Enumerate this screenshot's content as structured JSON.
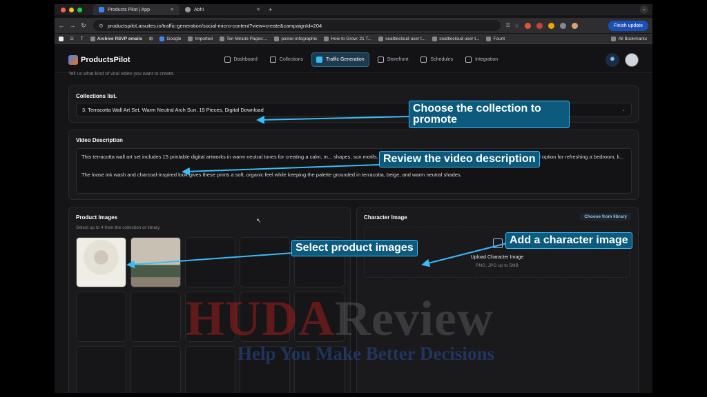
{
  "browser": {
    "tabs": [
      {
        "title": "Products Pilot | App"
      },
      {
        "title": "Abhi"
      }
    ],
    "url": "productspilot.aisuites.io/traffic-generation/social-micro-content?view=create&campaignId=204",
    "finish_update": "Finish update",
    "bookmarks": [
      "Archive RSVP emails",
      "Google",
      "Imported",
      "Ten Minute Pages:...",
      "poster-infographic",
      "How to Grow: 21 T...",
      "seattlecloud user t...",
      "seattlecloud user t...",
      "Fount"
    ],
    "all_bookmarks": "All Bookmarks",
    "bm_letters": [
      "D",
      "T"
    ]
  },
  "app": {
    "logo": "ProductsPilot",
    "nav": [
      {
        "label": "Dashboard",
        "active": false
      },
      {
        "label": "Collections",
        "active": false
      },
      {
        "label": "Traffic Generation",
        "active": true
      },
      {
        "label": "Storefront",
        "active": false
      },
      {
        "label": "Schedules",
        "active": false
      },
      {
        "label": "Integration",
        "active": false
      }
    ]
  },
  "content": {
    "subtext": "Tell us what kind of viral video you want to create.",
    "collections": {
      "title": "Collections list.",
      "selected": "3.   Terracotta Wall Art Set, Warm Neutral Arch Sun, 15 Pieces, Digital Download"
    },
    "video": {
      "title": "Video Description",
      "para1": "This terracotta wall art set includes 15 printable digital artworks in warm neutral tones for creating a calm, m... shapes, sun motifs, and earthy abstract decor, this bundle offers an easy instant-download option for refreshing a bedroom, li...",
      "para2": "The loose ink wash and charcoal-inspired look gives these prints a soft, organic feel while keeping the palette grounded in terracotta, beige, and warm neutral shades."
    },
    "product_images": {
      "title": "Product Images",
      "note": "Select up to 4 from the collection or library"
    },
    "character": {
      "title": "Character Image",
      "choose": "Choose from library",
      "upload_title": "Upload Character Image",
      "upload_sub": "PNG, JPG up to 5MB"
    }
  },
  "callouts": {
    "collection": "Choose the collection to promote",
    "description": "Review the video description",
    "images": "Select product images",
    "character": "Add a character image"
  },
  "watermark": {
    "main_a": "HUDA",
    "main_b": "Review",
    "sub": "Help You Make Better Decisions"
  },
  "colors": {
    "accent": "#38bdf8",
    "callout_bg": "#0c5a7e",
    "finish_btn": "#1b4fb8"
  }
}
